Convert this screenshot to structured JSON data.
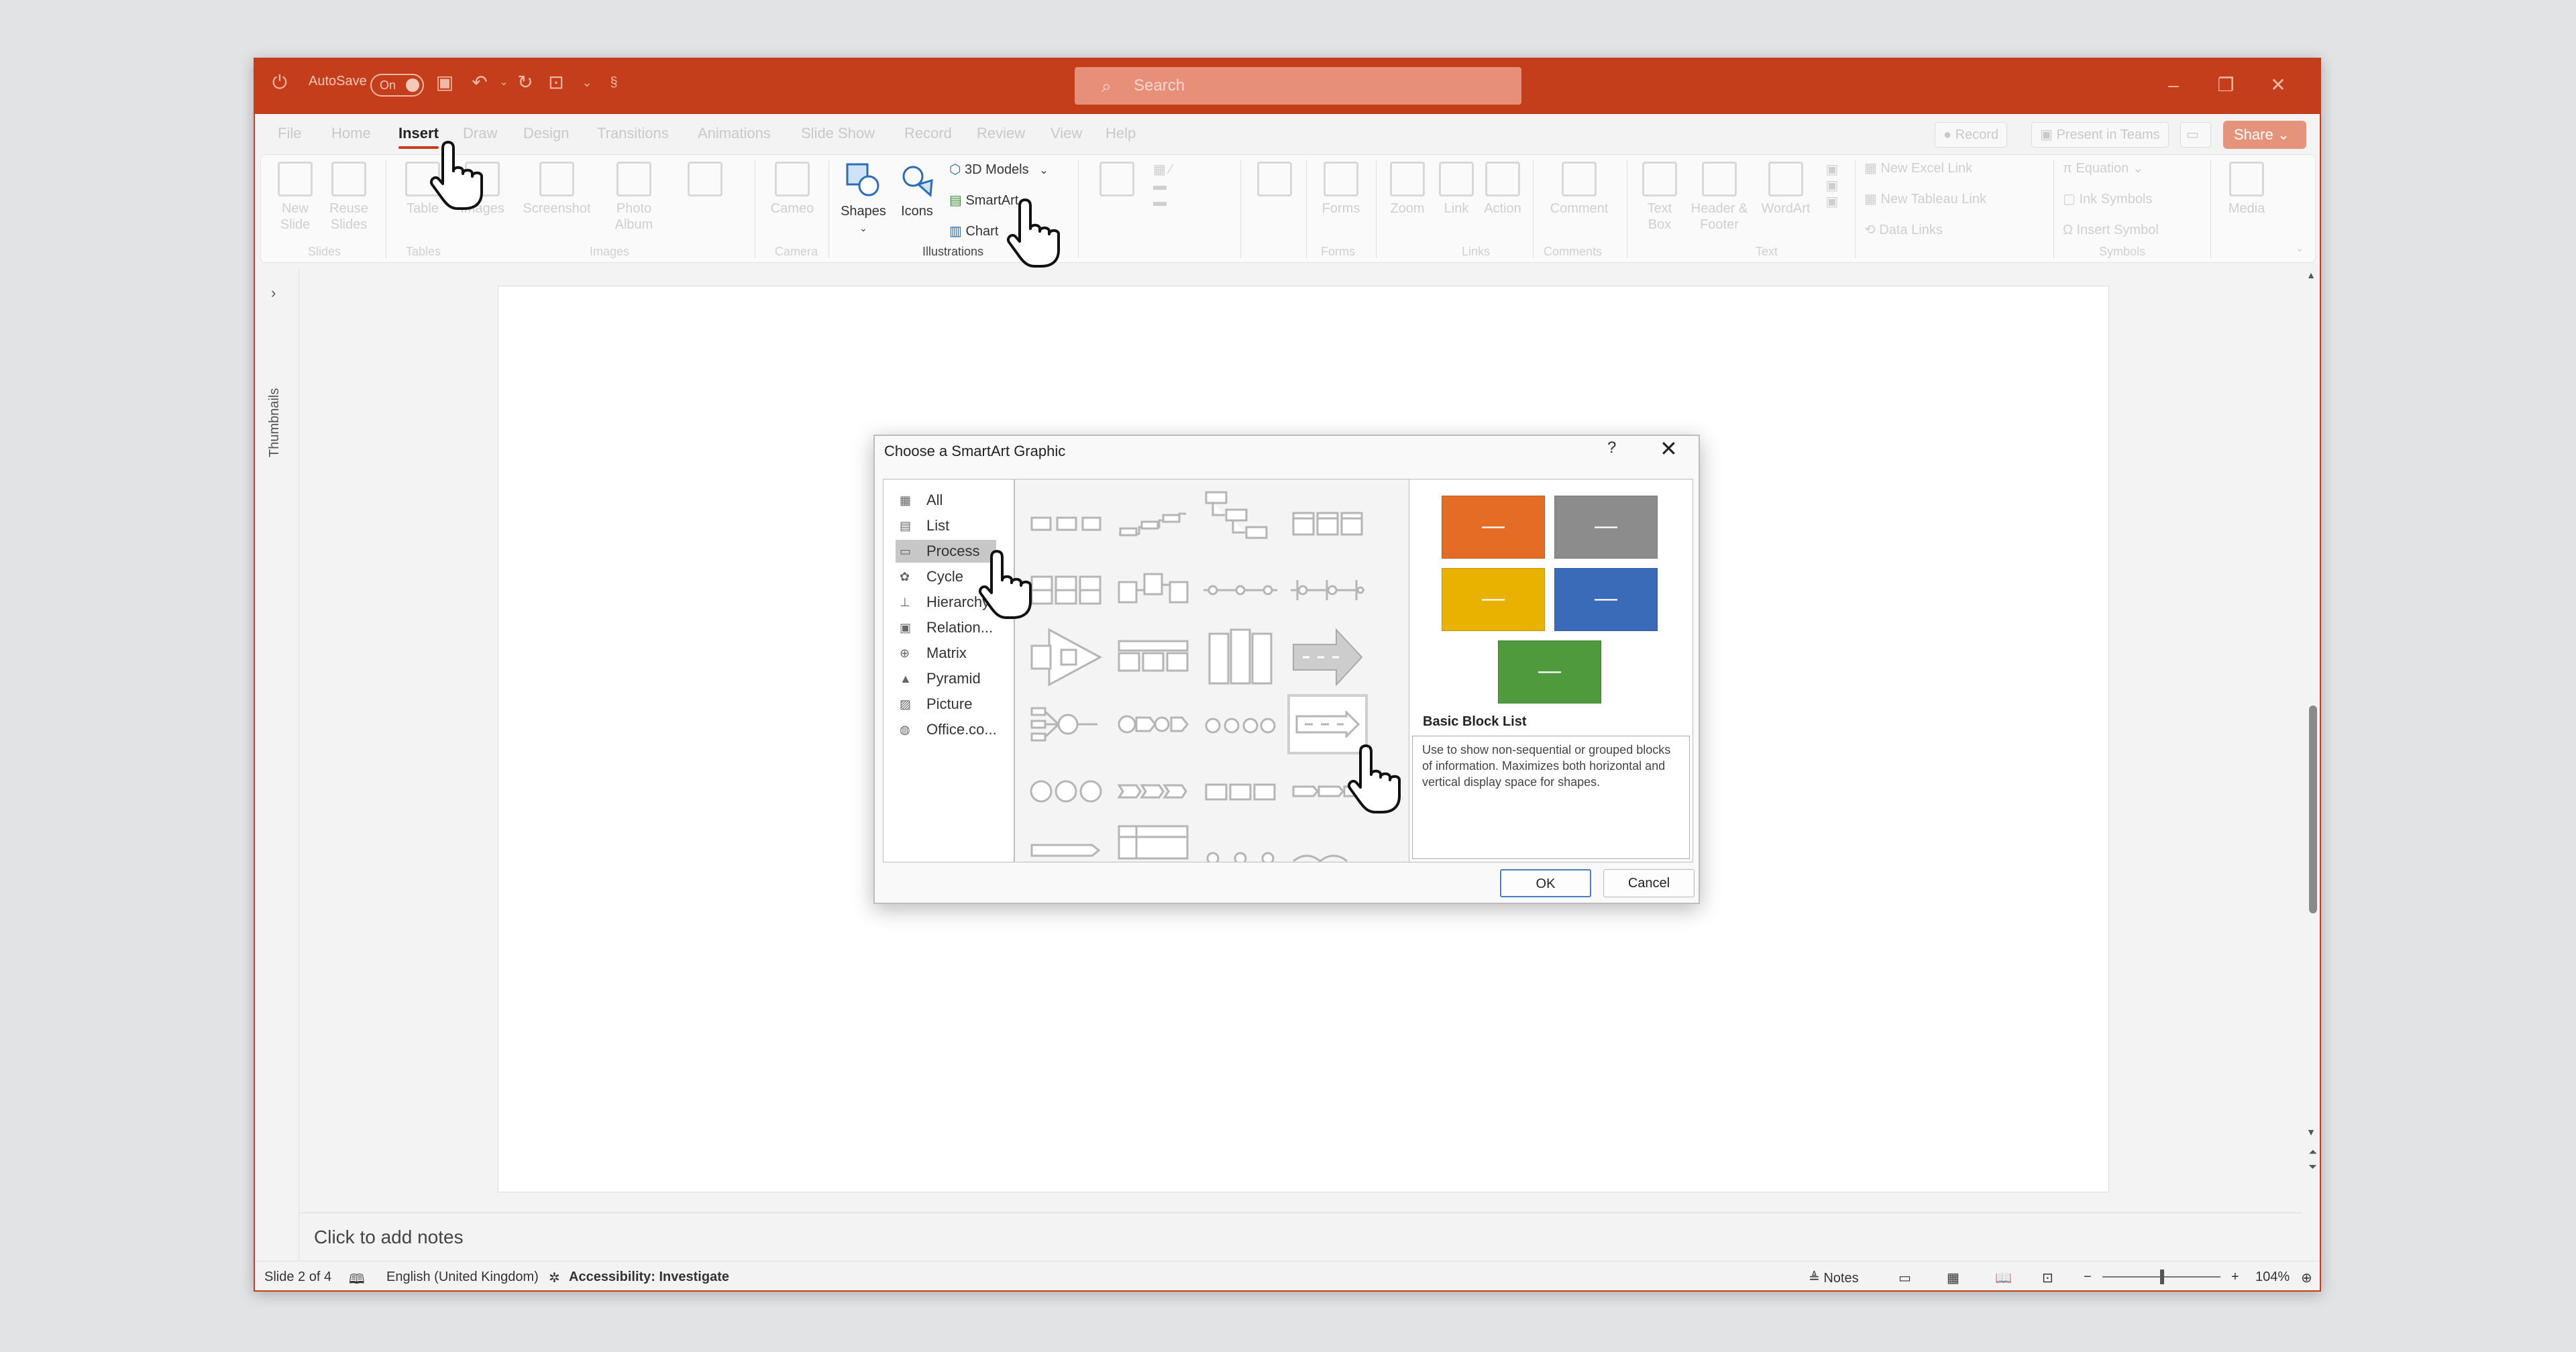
{
  "titlebar": {
    "autosave_label": "AutoSave",
    "autosave_state": "On",
    "search_placeholder": "Search"
  },
  "menu": {
    "tabs": [
      "File",
      "Home",
      "Insert",
      "Draw",
      "Design",
      "Transitions",
      "Animations",
      "Slide Show",
      "Record",
      "Review",
      "View",
      "Help"
    ],
    "active_tab": "Insert",
    "record_label": "Record",
    "teams_label": "Present in Teams",
    "share_label": "Share"
  },
  "ribbon": {
    "new_slide": "New Slide",
    "reuse_slides": "Reuse Slides",
    "table": "Table",
    "images": "Images",
    "screenshot": "Screenshot",
    "photo_album": "Photo Album",
    "cameo": "Cameo",
    "shapes": "Shapes",
    "icons": "Icons",
    "models_3d": "3D Models",
    "smartart": "SmartArt",
    "chart": "Chart",
    "forms": "Forms",
    "zoom": "Zoom",
    "link": "Link",
    "action": "Action",
    "comment": "Comment",
    "text_box": "Text Box",
    "header_footer": "Header & Footer",
    "wordart": "WordArt",
    "new_excel_link": "New Excel Link",
    "new_tableau_link": "New Tableau Link",
    "data_links": "Data Links",
    "equation": "Equation",
    "ink_symbols": "Ink Symbols",
    "insert_symbol": "Insert Symbol",
    "media": "Media",
    "groups": {
      "slides": "Slides",
      "tables": "Tables",
      "images": "Images",
      "camera": "Camera",
      "illustrations": "Illustrations",
      "forms": "Forms",
      "links": "Links",
      "comments": "Comments",
      "text": "Text",
      "symbols": "Symbols"
    }
  },
  "sidebar": {
    "label": "Thumbnails"
  },
  "notes": {
    "placeholder": "Click to add notes"
  },
  "status": {
    "slide": "Slide 2 of 4",
    "language": "English (United Kingdom)",
    "accessibility": "Accessibility: Investigate",
    "notes": "Notes",
    "zoom": "104%"
  },
  "dialog": {
    "title": "Choose a SmartArt Graphic",
    "help": "?",
    "categories": [
      "All",
      "List",
      "Process",
      "Cycle",
      "Hierarchy",
      "Relation...",
      "Matrix",
      "Pyramid",
      "Picture",
      "Office.co..."
    ],
    "selected_category": "Process",
    "preview_title": "Basic Block List",
    "preview_description": "Use to show non-sequential or grouped blocks of information. Maximizes both horizontal and vertical display space for shapes.",
    "ok": "OK",
    "cancel": "Cancel",
    "preview_colors": [
      "#e46c24",
      "#8c8c8c",
      "#e9b100",
      "#3a6bb8",
      "#4f9a3c"
    ]
  }
}
